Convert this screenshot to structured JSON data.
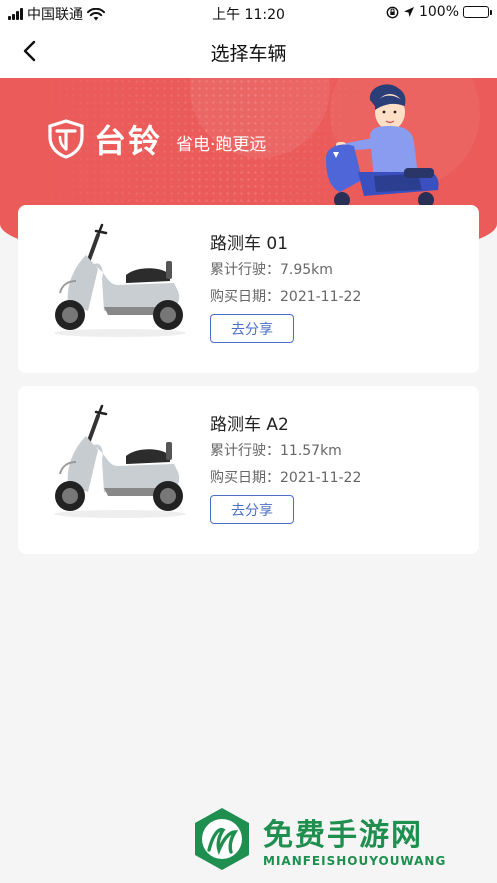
{
  "status_bar": {
    "carrier": "中国联通",
    "time": "上午 11:20",
    "battery": "100%",
    "battery_level": 1.0
  },
  "nav": {
    "title": "选择车辆"
  },
  "banner": {
    "brand": "台铃",
    "slogan": "省电·跑更远"
  },
  "vehicles": [
    {
      "name": "路测车 01",
      "mileage": "累计行驶：7.95km",
      "purchase_date": "购买日期：2021-11-22",
      "share_label": "去分享"
    },
    {
      "name": "路测车 A2",
      "mileage": "累计行驶：11.57km",
      "purchase_date": "购买日期：2021-11-22",
      "share_label": "去分享"
    }
  ],
  "watermark": {
    "title": "免费手游网",
    "subtitle": "MIANFEISHOUYOUWANG"
  },
  "colors": {
    "banner": "#ea5b59",
    "accent": "#4a6fc4",
    "watermark": "#1e8f4f"
  }
}
